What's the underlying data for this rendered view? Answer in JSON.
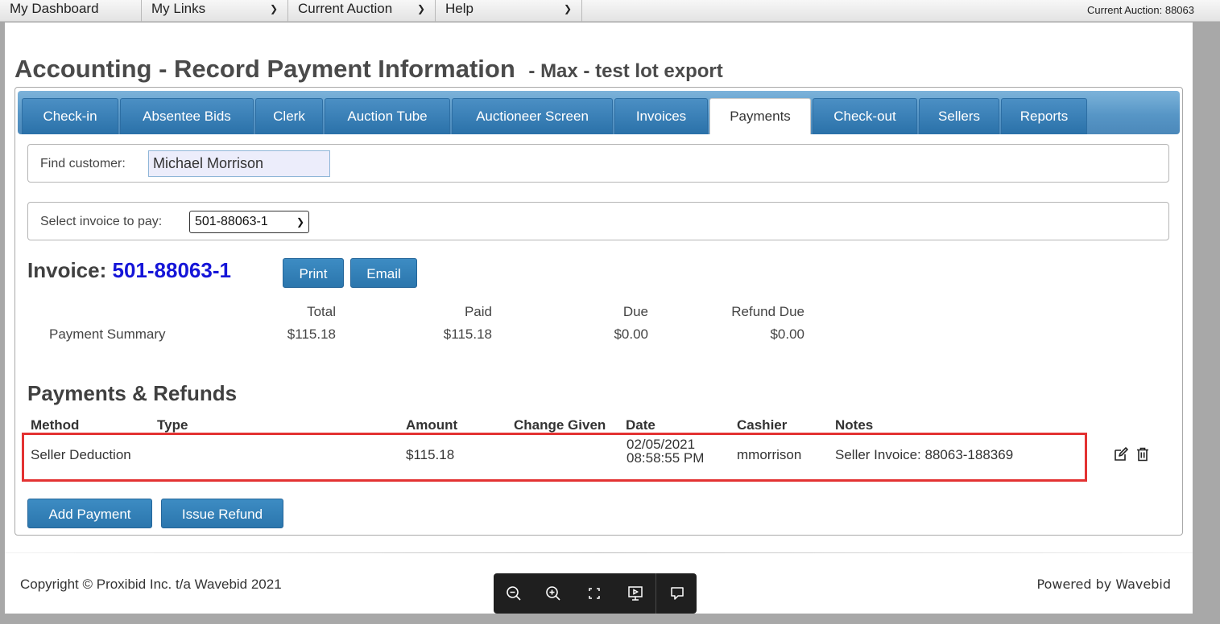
{
  "nav": {
    "items": [
      {
        "label": "My Dashboard",
        "has_menu": false
      },
      {
        "label": "My Links",
        "has_menu": true
      },
      {
        "label": "Current Auction",
        "has_menu": true
      },
      {
        "label": "Help",
        "has_menu": true
      }
    ],
    "current_auction": "Current Auction: 88063"
  },
  "page": {
    "title": "Accounting - Record Payment Information",
    "subtitle": "- Max - test lot export"
  },
  "tabs": [
    {
      "label": "Check-in",
      "active": false
    },
    {
      "label": "Absentee Bids",
      "active": false
    },
    {
      "label": "Clerk",
      "active": false
    },
    {
      "label": "Auction Tube",
      "active": false
    },
    {
      "label": "Auctioneer Screen",
      "active": false
    },
    {
      "label": "Invoices",
      "active": false
    },
    {
      "label": "Payments",
      "active": true
    },
    {
      "label": "Check-out",
      "active": false
    },
    {
      "label": "Sellers",
      "active": false
    },
    {
      "label": "Reports",
      "active": false
    }
  ],
  "find_customer": {
    "label": "Find customer:",
    "value": "Michael Morrison"
  },
  "invoice_select": {
    "label": "Select invoice to pay:",
    "value": "501-88063-1"
  },
  "invoice": {
    "prefix": "Invoice:",
    "number": "501-88063-1",
    "print_label": "Print",
    "email_label": "Email"
  },
  "summary": {
    "row_label": "Payment Summary",
    "headers": [
      "Total",
      "Paid",
      "Due",
      "Refund Due"
    ],
    "values": [
      "$115.18",
      "$115.18",
      "$0.00",
      "$0.00"
    ]
  },
  "payments": {
    "title": "Payments & Refunds",
    "columns": [
      "Method",
      "Type",
      "Amount",
      "Change Given",
      "Date",
      "Cashier",
      "Notes"
    ],
    "rows": [
      {
        "method": "Seller Deduction",
        "type": "",
        "amount": "$115.18",
        "change_given": "",
        "date": "02/05/2021",
        "time": "08:58:55 PM",
        "cashier": "mmorrison",
        "notes": "Seller Invoice: 88063-188369"
      }
    ],
    "add_payment_label": "Add Payment",
    "issue_refund_label": "Issue Refund"
  },
  "footer": {
    "copyright": "Copyright © Proxibid Inc. t/a Wavebid 2021",
    "powered_by": "Powered by Wavebid"
  },
  "viewer_toolbar": {
    "buttons": [
      "zoom-out-icon",
      "zoom-in-icon",
      "fit-screen-icon",
      "present-icon",
      "comment-icon"
    ]
  },
  "colors": {
    "tab_blue": "#2a71a9",
    "invoice_number": "#1515d8",
    "highlight": "#e33232"
  }
}
